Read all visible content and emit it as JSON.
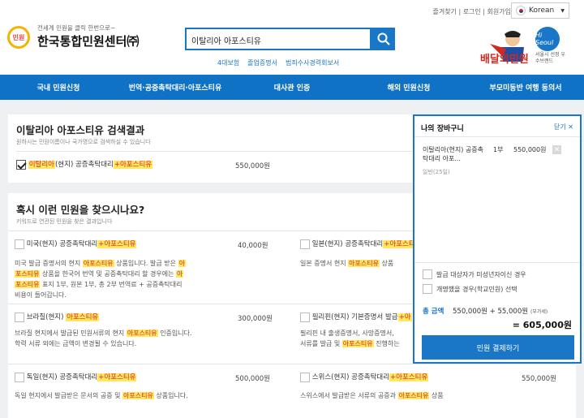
{
  "header": {
    "util_links": "즐겨찾기 | 로그인 | 회원가입",
    "language": "Korean",
    "logo_mark": "민원",
    "logo_sub": "전세계 민원을 클릭 한번으로~",
    "logo_main": "한국통합민원센터㈜",
    "search_value": "이탈리아 아포스티유",
    "quick_links": [
      "4대보험",
      "졸업증명서",
      "범죄수사경력회보서"
    ],
    "ad_title": "배달의민원",
    "ad_badge": "Hi Seoul",
    "ad_caption": "서울시 선정 우수브랜드"
  },
  "nav": [
    "국내 민원신청",
    "번역·공증촉탁대리·아포스티유",
    "대사관 인증",
    "해외 민원신청",
    "부모미동반 여행 동의서"
  ],
  "results": {
    "title": "이탈리아 아포스티유 검색결과",
    "subtitle": "원하시는 민원이름이나 국가명으로 검색하실 수 있습니다",
    "item_pre": "이탈리아",
    "item_mid": "(현지) 공증촉탁대리",
    "item_post": "+아포스티유",
    "item_price": "550,000원"
  },
  "suggest": {
    "title": "혹시 이런 민원을 찾으시나요?",
    "subtitle": "키워드로 연관된 민원을 찾은 결과입니다",
    "items": [
      {
        "name": "미국(현지) 공증촉탁대리",
        "tail": "+아포스티유",
        "price": "40,000원",
        "d1a": "미국 발급 증명서의 현지 ",
        "d1b": "아포스티유",
        "d1c": " 상품입니다. 발급 받은 ",
        "d1d": "아",
        "d2a": "포스티유",
        "d2b": " 상품을 한국어 번역 및 공증촉탁대리 할 경우에는 ",
        "d2c": "아",
        "d3a": "포스티유",
        "d3b": " 표지 1부, 원본 1부, 총 2부 번역료 + 공증촉탁대리",
        "d4": "비용이 들어갑니다."
      },
      {
        "name": "일본(현지) 공증촉탁대리",
        "tail": "+아포스티유",
        "d1a": "일본 증명서 현지 ",
        "d1b": "아포스티유",
        "d1c": " 상품"
      },
      {
        "name": "브라질(현지) ",
        "tail": "아포스티유",
        "price": "300,000원",
        "d1a": "브라질 현지에서 발급된 민원서류의 현지 ",
        "d1b": "아포스티유",
        "d1c": " 인증입니다.",
        "d2": "학력 서류 외에는 금액이 변경될 수 있습니다."
      },
      {
        "name": "필리핀(현지) 기본증명서 발급",
        "tail": "+아",
        "d1": "필리핀 내 출생증명서, 사망증명서,",
        "d2a": "서류를 발급 및 ",
        "d2b": "아포스티유",
        "d2c": " 진행하는"
      },
      {
        "name": "독일(현지) 공증촉탁대리",
        "tail": "+아포스티유",
        "price": "500,000원",
        "d1a": "독일 현지에서 발급받은 문서의 공증 및 ",
        "d1b": "아포스티유",
        "d1c": " 상품입니다."
      },
      {
        "name": "스위스(현지) 공증촉탁대리",
        "tail": "+아포스티유",
        "price": "550,000원",
        "d1a": "스위스에서 발급받은 서류의 공증과 ",
        "d1b": "아포스티유",
        "d1c": " 상품"
      }
    ]
  },
  "cart": {
    "title": "나의 장바구니",
    "close": "닫기",
    "item_name": "이탈리아(현지) 공증촉탁대리 아포...",
    "item_note": "일반(25일)",
    "item_qty": "1부",
    "item_price": "550,000원",
    "opt1": "발급 대상자가 미성년자이신 경우",
    "opt2": "개명했을 경우(학교민원) 선택",
    "total_label": "총 금액",
    "total_formula": "550,000원 + 55,000원",
    "total_vat": "(부가세)",
    "total_value": "= 605,000원",
    "pay": "민원 결제하기"
  },
  "colors": {
    "brand": "#1a77c8",
    "highlight": "#ffe85e",
    "accent_red": "#d02a1e"
  }
}
